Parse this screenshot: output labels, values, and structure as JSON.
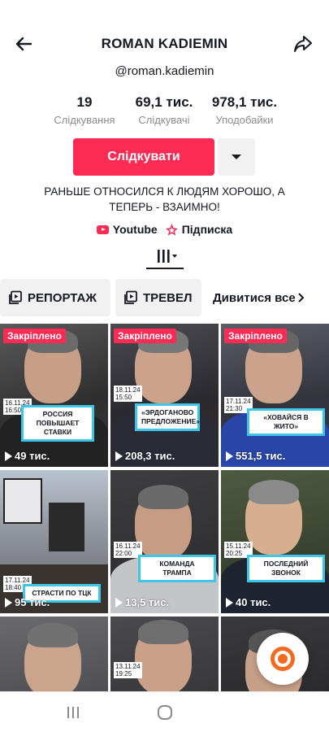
{
  "header": {
    "title": "ROMAN KADIEMIN",
    "back_icon": "arrow-left-icon",
    "share_icon": "share-arrow-icon"
  },
  "profile": {
    "handle": "@roman.kadiemin",
    "stats": [
      {
        "value": "19",
        "label": "Слідкування"
      },
      {
        "value": "69,1 тис.",
        "label": "Слідкувачі"
      },
      {
        "value": "978,1 тис.",
        "label": "Уподобайки"
      }
    ],
    "follow_label": "Слідкувати",
    "bio": "РАНЬШЕ ОТНОСИЛСЯ К ЛЮДЯМ ХОРОШО, А ТЕПЕРЬ - ВЗАИМНО!",
    "links": [
      {
        "label": "Youtube",
        "icon": "youtube-icon"
      },
      {
        "label": "Підписка",
        "icon": "subscription-icon"
      }
    ]
  },
  "playlists": {
    "items": [
      {
        "label": "РЕПОРТАЖ",
        "icon": "playlist-icon"
      },
      {
        "label": "ТРЕВЕЛ",
        "icon": "playlist-icon"
      }
    ],
    "see_all": "Дивитися все"
  },
  "colors": {
    "accent": "#fe2c55",
    "caption_border": "#3ec6e8",
    "fab": "#f36b21"
  },
  "videos": [
    {
      "pinned": "Закріплено",
      "date": "16.11.24\n16:50",
      "caption": "РОССИЯ ПОВЫШАЕТ СТАВКИ",
      "views": "49 тис."
    },
    {
      "pinned": "Закріплено",
      "date": "18.11.24\n15:50",
      "caption": "«ЭРДОГАНОВО ПРЕДЛОЖЕНИЕ»",
      "views": "208,3 тис."
    },
    {
      "pinned": "Закріплено",
      "date": "17.11.24\n21:30",
      "caption": "«ХОВАЙСЯ В ЖИТО»",
      "views": "551,5 тис."
    },
    {
      "pinned": "",
      "date": "17.11.24\n18:40",
      "caption": "СТРАСТИ ПО ТЦК",
      "views": "95 тис."
    },
    {
      "pinned": "",
      "date": "16.11.24\n22:00",
      "caption": "КОМАНДА ТРАМПА",
      "views": "13,5 тис."
    },
    {
      "pinned": "",
      "date": "15.11.24\n20:25",
      "caption": "ПОСЛЕДНИЙ ЗВОНОК",
      "views": "40 тис."
    },
    {
      "pinned": "",
      "date": "",
      "caption": "",
      "views": ""
    },
    {
      "pinned": "",
      "date": "13.11.24\n19:25",
      "caption": "",
      "views": ""
    },
    {
      "pinned": "",
      "date": "",
      "caption": "",
      "views": ""
    }
  ]
}
